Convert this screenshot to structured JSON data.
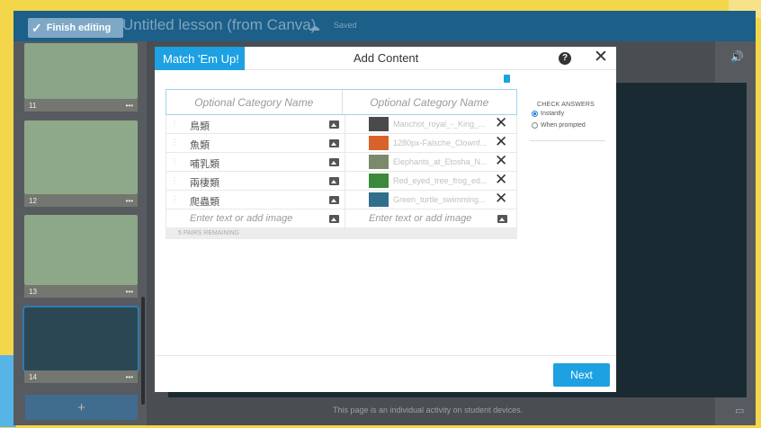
{
  "topbar": {
    "finish_label": "Finish editing",
    "lesson_title": "Untitled lesson (from Canva)",
    "saved_status": "Saved"
  },
  "slides": [
    {
      "number": "11",
      "menu": "•••"
    },
    {
      "number": "12",
      "menu": "•••"
    },
    {
      "number": "13",
      "menu": "•••"
    },
    {
      "number": "14",
      "menu": "•••"
    }
  ],
  "add_slide_label": "+",
  "modal": {
    "tab_label": "Match 'Em Up!",
    "title": "Add Content",
    "help_label": "?",
    "close_label": "✕",
    "categories": [
      "Optional Category Name",
      "Optional Category Name"
    ],
    "pairs": [
      {
        "left": "鳥類",
        "right": "Manchot_royal_-_King_...",
        "thumb_color": "#4a4a4a"
      },
      {
        "left": "魚類",
        "right": "1280px-Falsche_Clownf...",
        "thumb_color": "#d8632a"
      },
      {
        "left": "哺乳類",
        "right": "Elephants_at_Etosha_N...",
        "thumb_color": "#7a8a6a"
      },
      {
        "left": "兩棲類",
        "right": "Red_eyed_tree_frog_ed...",
        "thumb_color": "#3a8a3a"
      },
      {
        "left": "爬蟲類",
        "right": "Green_turtle_swimming...",
        "thumb_color": "#2f6f8a"
      }
    ],
    "placeholder_left": "Enter text or add image",
    "placeholder_right": "Enter text or add image",
    "remaining": "5 PAIRS REMAINING",
    "check_answers": {
      "title": "CHECK ANSWERS",
      "options": [
        "Instantly",
        "When prompted"
      ],
      "selected": "Instantly"
    },
    "next_label": "Next"
  },
  "footer_note": "This page is an individual activity on student devices.",
  "colors": {
    "accent": "#1da1e2",
    "topbar": "#1c5f88",
    "frame": "#f3d64a"
  }
}
